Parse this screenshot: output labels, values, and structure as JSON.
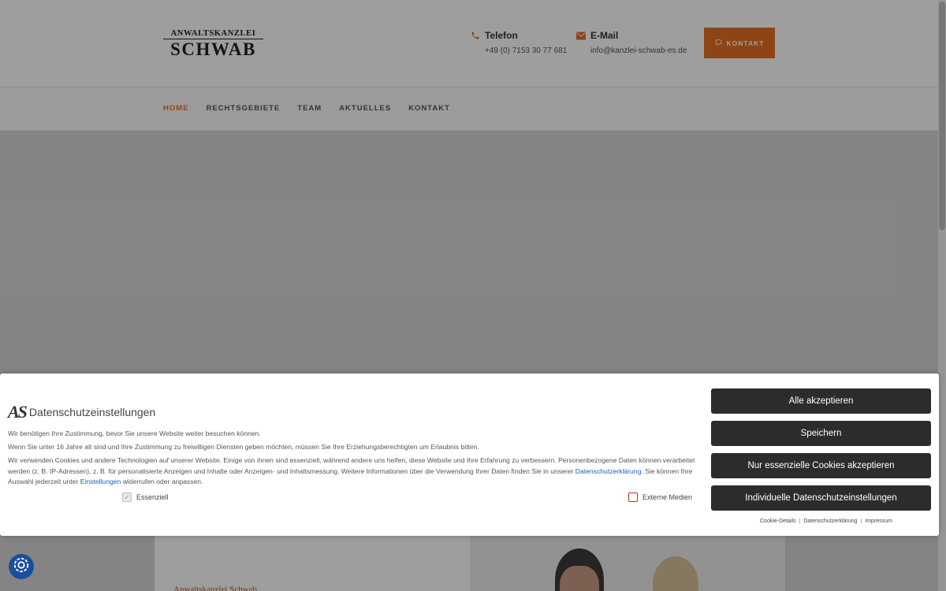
{
  "logo": {
    "line1": "ANWALTSKANZLEI",
    "line2": "SCHWAB"
  },
  "contact": {
    "phone_label": "Telefon",
    "phone_value": "+49 (0) 7153 30 77 681",
    "email_label": "E-Mail",
    "email_value": "info@kanzlei-schwab-es.de",
    "button_label": "KONTAKT"
  },
  "nav": {
    "items": [
      {
        "label": "HOME",
        "active": true
      },
      {
        "label": "RECHTSGEBIETE",
        "active": false
      },
      {
        "label": "TEAM",
        "active": false
      },
      {
        "label": "AKTUELLES",
        "active": false
      },
      {
        "label": "KONTAKT",
        "active": false
      }
    ]
  },
  "card": {
    "title": "Anwaltskanzlei Schwab"
  },
  "cookie": {
    "logo_text": "AS",
    "title": "Datenschutzeinstellungen",
    "p1": "Wir benötigen Ihre Zustimmung, bevor Sie unsere Website weiter besuchen können.",
    "p2": "Wenn Sie unter 16 Jahre alt sind und Ihre Zustimmung zu freiwilligen Diensten geben möchten, müssen Sie Ihre Erziehungsberechtigten um Erlaubnis bitten.",
    "p3_a": "Wir verwenden Cookies und andere Technologien auf unserer Website. Einige von ihnen sind essenziell, während andere uns helfen, diese Website und Ihre Erfahrung zu verbessern. Personenbezogene Daten können verarbeitet werden (z. B. IP-Adressen), z. B. für personalisierte Anzeigen und Inhalte oder Anzeigen- und Inhaltsmessung. Weitere Informationen über die Verwendung Ihrer Daten finden Sie in unserer ",
    "p3_link1": "Datenschutzerklärung",
    "p3_b": ". Sie können Ihre Auswahl jederzeit unter ",
    "p3_link2": "Einstellungen",
    "p3_c": " widerrufen oder anpassen.",
    "check_essential": "Essenziell",
    "check_external": "Externe Medien",
    "btn_accept_all": "Alle akzeptieren",
    "btn_save": "Speichern",
    "btn_essential_only": "Nur essenzielle Cookies akzeptieren",
    "btn_individual": "Individuelle Datenschutzeinstellungen",
    "link_details": "Cookie-Details",
    "link_privacy": "Datenschutzerklärung",
    "link_imprint": "Impressum",
    "separator": "|"
  },
  "colors": {
    "accent": "#e76f23",
    "dark_button": "#2c2c2c",
    "link": "#1a5fb4"
  }
}
